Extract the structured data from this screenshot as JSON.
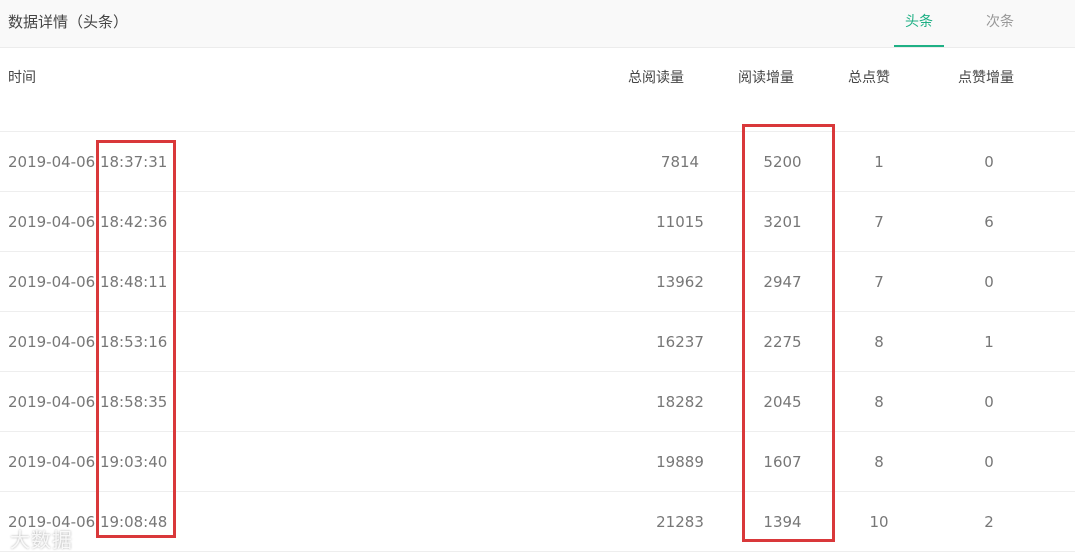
{
  "header": {
    "title": "数据详情（头条）",
    "tabs": [
      {
        "label": "头条",
        "active": true
      },
      {
        "label": "次条",
        "active": false
      }
    ]
  },
  "table": {
    "columns": [
      "时间",
      "总阅读量",
      "阅读增量",
      "总点赞",
      "点赞增量"
    ],
    "rows": [
      [
        "2019-04-06 18:37:31",
        "7814",
        "5200",
        "1",
        "0"
      ],
      [
        "2019-04-06 18:42:36",
        "11015",
        "3201",
        "7",
        "6"
      ],
      [
        "2019-04-06 18:48:11",
        "13962",
        "2947",
        "7",
        "0"
      ],
      [
        "2019-04-06 18:53:16",
        "16237",
        "2275",
        "8",
        "1"
      ],
      [
        "2019-04-06 18:58:35",
        "18282",
        "2045",
        "8",
        "0"
      ],
      [
        "2019-04-06 19:03:40",
        "19889",
        "1607",
        "8",
        "0"
      ],
      [
        "2019-04-06 19:08:48",
        "21283",
        "1394",
        "10",
        "2"
      ]
    ]
  },
  "watermark": "大数据",
  "colors": {
    "accent": "#1fb085",
    "highlight": "#d9383a"
  }
}
